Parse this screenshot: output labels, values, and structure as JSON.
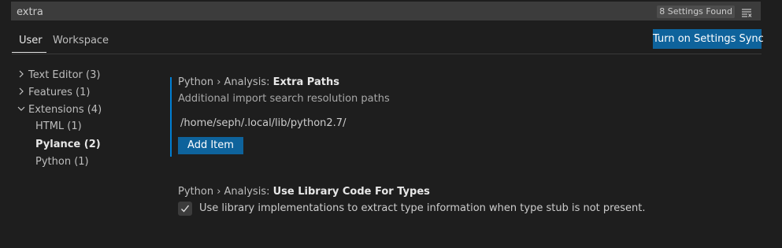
{
  "search": {
    "value": "extra",
    "results_badge": "8 Settings Found",
    "icon": "filter-icon"
  },
  "tabs": [
    {
      "label": "User",
      "active": true
    },
    {
      "label": "Workspace",
      "active": false
    }
  ],
  "sync_button": {
    "label": "Turn on Settings Sync"
  },
  "toc": [
    {
      "label": "Text Editor (3)",
      "icon": "chevron-right-icon"
    },
    {
      "label": "Features (1)",
      "icon": "chevron-right-icon"
    },
    {
      "label": "Extensions (4)",
      "icon": "chevron-down-icon"
    },
    {
      "label": "HTML (1)"
    },
    {
      "label": "Pylance (2)",
      "active": true
    },
    {
      "label": "Python (1)"
    }
  ],
  "settings": [
    {
      "category": "Python › Analysis: ",
      "name": "Extra Paths",
      "description": "Additional import search resolution paths",
      "items": [
        "/home/seph/.local/lib/python2.7/"
      ],
      "add_button": "Add Item"
    },
    {
      "category": "Python › Analysis: ",
      "name": "Use Library Code For Types",
      "checked": true,
      "checkbox_label": "Use library implementations to extract type information when type stub is not present."
    }
  ],
  "colors": {
    "background": "#1e1e1e",
    "input_background": "#3c3c3c",
    "button": "#0e639c",
    "focus_indicator": "#007fd4"
  }
}
